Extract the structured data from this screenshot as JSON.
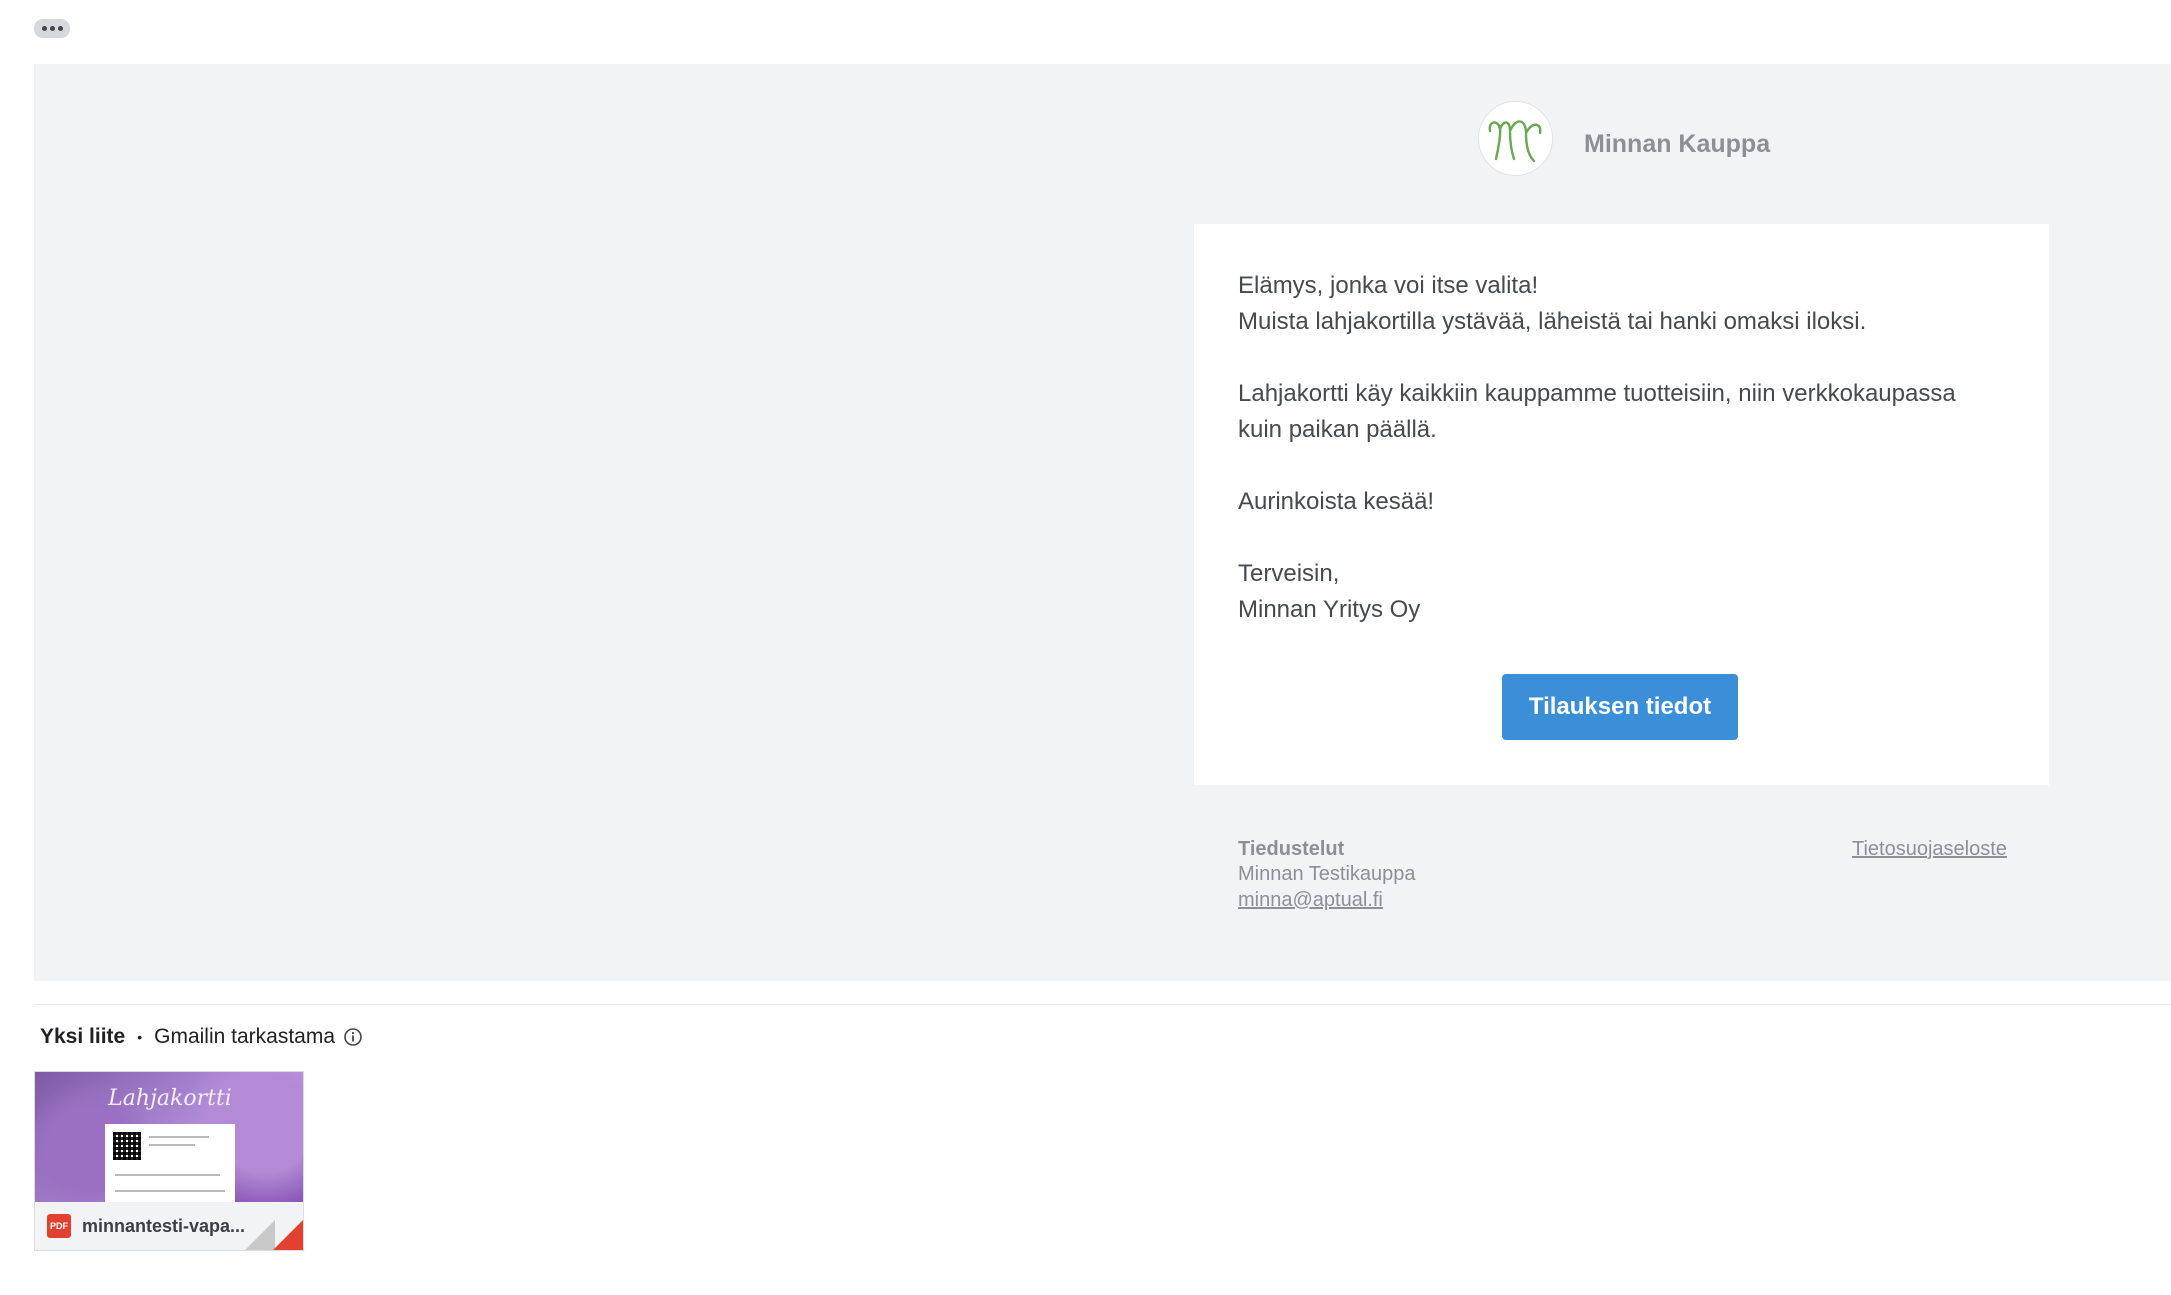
{
  "toolbar": {
    "more_label": ""
  },
  "header": {
    "store_name": "Minnan Kauppa",
    "logo_letter": "M"
  },
  "message": {
    "paragraphs": [
      [
        "Elämys, jonka voi itse valita!",
        "Muista lahjakortilla ystävää, läheistä tai hanki omaksi iloksi."
      ],
      [
        "Lahjakortti käy kaikkiin kauppamme tuotteisiin, niin verkkokaupassa",
        "kuin paikan päällä."
      ],
      [
        "Aurinkoista kesää!"
      ],
      [
        "Terveisin,",
        "Minnan Yritys Oy"
      ]
    ],
    "cta_label": "Tilauksen tiedot"
  },
  "footer": {
    "title": "Tiedustelut",
    "company": "Minnan Testikauppa",
    "email": "minna@aptual.fi",
    "privacy_link": "Tietosuojaseloste"
  },
  "attachments": {
    "count_label": "Yksi liite",
    "separator": "•",
    "scan_label": "Gmailin tarkastama",
    "items": [
      {
        "thumb_title": "Lahjakortti",
        "file_type": "PDF",
        "file_name": "minnantesti-vapa..."
      }
    ]
  },
  "colors": {
    "accent": "#3b8ed8",
    "email_bg": "#f2f3f5",
    "logo_green": "#6aa84f",
    "pdf_red": "#e2412f"
  }
}
